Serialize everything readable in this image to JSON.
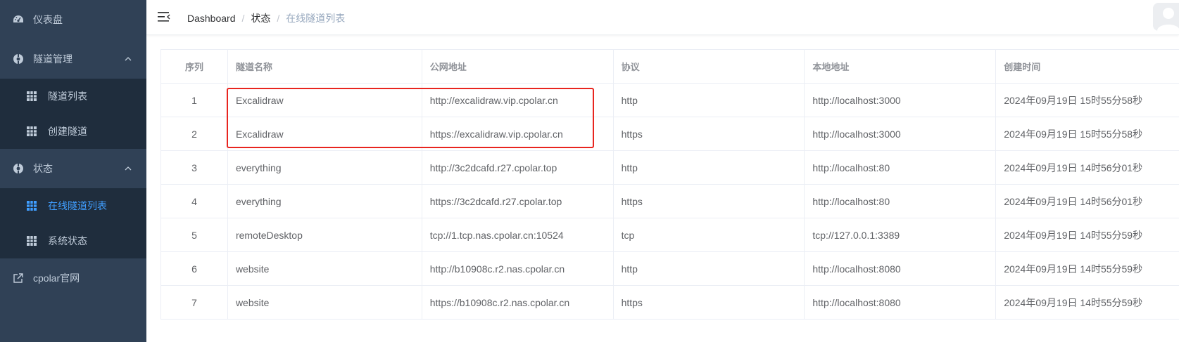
{
  "sidebar": {
    "items": [
      {
        "label": "仪表盘",
        "icon": "dashboard-icon"
      },
      {
        "label": "隧道管理",
        "icon": "tunnel-icon",
        "expanded": true,
        "children": [
          {
            "label": "隧道列表",
            "icon": "grid-icon"
          },
          {
            "label": "创建隧道",
            "icon": "grid-icon"
          }
        ]
      },
      {
        "label": "状态",
        "icon": "status-icon",
        "expanded": true,
        "children": [
          {
            "label": "在线隧道列表",
            "icon": "grid-icon",
            "active": true
          },
          {
            "label": "系统状态",
            "icon": "grid-icon"
          }
        ]
      },
      {
        "label": "cpolar官网",
        "icon": "external-link-icon"
      }
    ]
  },
  "breadcrumb": {
    "items": [
      "Dashboard",
      "状态",
      "在线隧道列表"
    ],
    "separator": "/"
  },
  "table": {
    "columns": [
      "序列",
      "隧道名称",
      "公网地址",
      "协议",
      "本地地址",
      "创建时间"
    ],
    "rows": [
      [
        "1",
        "Excalidraw",
        "http://excalidraw.vip.cpolar.cn",
        "http",
        "http://localhost:3000",
        "2024年09月19日 15时55分58秒"
      ],
      [
        "2",
        "Excalidraw",
        "https://excalidraw.vip.cpolar.cn",
        "https",
        "http://localhost:3000",
        "2024年09月19日 15时55分58秒"
      ],
      [
        "3",
        "everything",
        "http://3c2dcafd.r27.cpolar.top",
        "http",
        "http://localhost:80",
        "2024年09月19日 14时56分01秒"
      ],
      [
        "4",
        "everything",
        "https://3c2dcafd.r27.cpolar.top",
        "https",
        "http://localhost:80",
        "2024年09月19日 14时56分01秒"
      ],
      [
        "5",
        "remoteDesktop",
        "tcp://1.tcp.nas.cpolar.cn:10524",
        "tcp",
        "tcp://127.0.0.1:3389",
        "2024年09月19日 14时55分59秒"
      ],
      [
        "6",
        "website",
        "http://b10908c.r2.nas.cpolar.cn",
        "http",
        "http://localhost:8080",
        "2024年09月19日 14时55分59秒"
      ],
      [
        "7",
        "website",
        "https://b10908c.r2.nas.cpolar.cn",
        "https",
        "http://localhost:8080",
        "2024年09月19日 14时55分59秒"
      ]
    ]
  },
  "colors": {
    "sidebar_bg": "#304156",
    "submenu_bg": "#1f2d3d",
    "menu_text": "#bfcbd9",
    "active": "#409eff",
    "highlight_box": "#e8251f"
  }
}
